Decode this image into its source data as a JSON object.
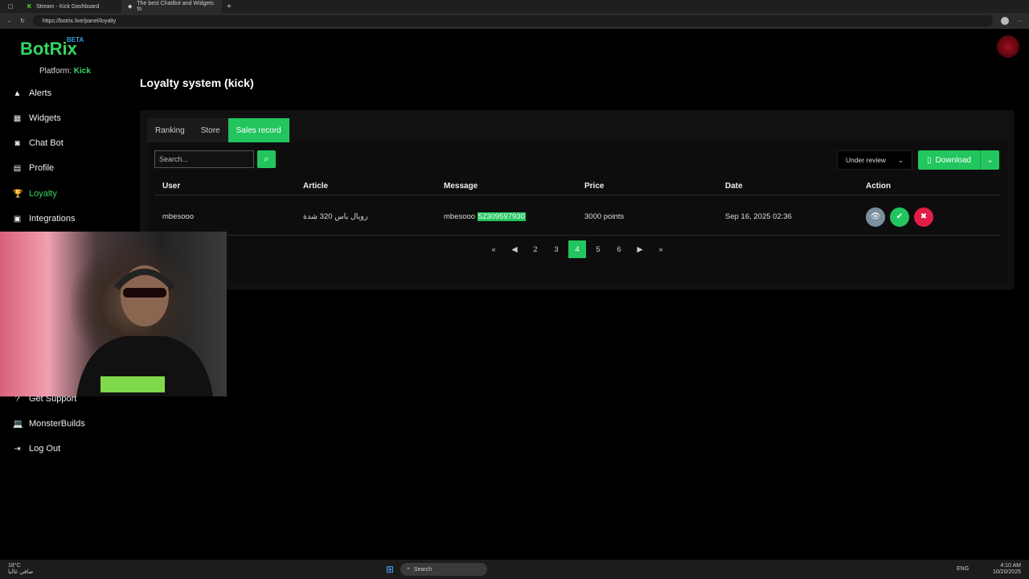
{
  "browser": {
    "tabs": [
      {
        "label": "Stream - Kick Dashboard"
      },
      {
        "label": "The best ChatBot and Widgets fo"
      }
    ],
    "url": "https://botrix.live/panel/loyalty"
  },
  "sidebar": {
    "logo": "BotRix",
    "beta": "BETA",
    "platform_label": "Platform:",
    "platform_value": "Kick",
    "items": [
      {
        "label": "Alerts"
      },
      {
        "label": "Widgets"
      },
      {
        "label": "Chat Bot"
      },
      {
        "label": "Profile"
      },
      {
        "label": "Loyalty"
      },
      {
        "label": "Integrations"
      },
      {
        "label": "Get Support"
      },
      {
        "label": "MonsterBuilds"
      },
      {
        "label": "Log Out"
      }
    ]
  },
  "main": {
    "title": "Loyalty system (kick)",
    "tabs": [
      {
        "label": "Ranking"
      },
      {
        "label": "Store"
      },
      {
        "label": "Sales record"
      }
    ],
    "search_placeholder": "Search...",
    "filter": "Under review",
    "download": "Download",
    "columns": [
      "User",
      "Article",
      "Message",
      "Price",
      "Date",
      "Action"
    ],
    "rows": [
      {
        "user": "mbesooo",
        "article": "رويال باس 320 شدة",
        "message_prefix": "mbesooo",
        "message_highlight": "52309597930",
        "price": "3000 points",
        "date": "Sep 16, 2025 02:36"
      }
    ],
    "pages": [
      "2",
      "3",
      "4",
      "5",
      "6"
    ],
    "current_page": "4"
  },
  "taskbar": {
    "weather_temp": "18°C",
    "weather_desc": "صافي غالبا",
    "search": "Search",
    "lang": "ENG",
    "time": "4:10 AM",
    "date": "10/20/2025"
  },
  "colors": {
    "accent": "#22c55e",
    "danger": "#e11d48",
    "muted": "#7b8f9e"
  }
}
